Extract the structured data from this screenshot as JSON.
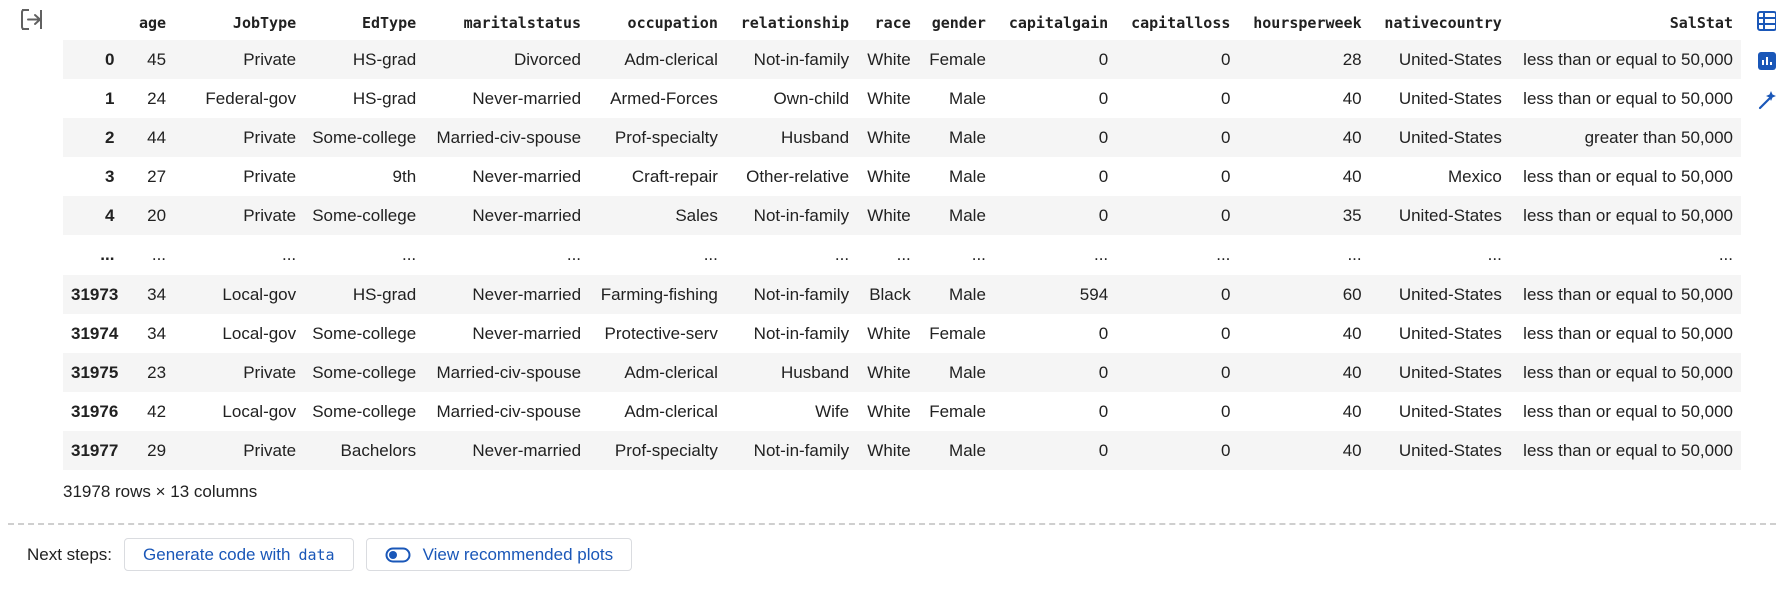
{
  "table": {
    "columns": [
      "",
      "age",
      "JobType",
      "EdType",
      "maritalstatus",
      "occupation",
      "relationship",
      "race",
      "gender",
      "capitalgain",
      "capitalloss",
      "hoursperweek",
      "nativecountry",
      "SalStat"
    ],
    "rows": [
      [
        "0",
        "45",
        "Private",
        "HS-grad",
        "Divorced",
        "Adm-clerical",
        "Not-in-family",
        "White",
        "Female",
        "0",
        "0",
        "28",
        "United-States",
        "less than or equal to 50,000"
      ],
      [
        "1",
        "24",
        "Federal-gov",
        "HS-grad",
        "Never-married",
        "Armed-Forces",
        "Own-child",
        "White",
        "Male",
        "0",
        "0",
        "40",
        "United-States",
        "less than or equal to 50,000"
      ],
      [
        "2",
        "44",
        "Private",
        "Some-college",
        "Married-civ-spouse",
        "Prof-specialty",
        "Husband",
        "White",
        "Male",
        "0",
        "0",
        "40",
        "United-States",
        "greater than 50,000"
      ],
      [
        "3",
        "27",
        "Private",
        "9th",
        "Never-married",
        "Craft-repair",
        "Other-relative",
        "White",
        "Male",
        "0",
        "0",
        "40",
        "Mexico",
        "less than or equal to 50,000"
      ],
      [
        "4",
        "20",
        "Private",
        "Some-college",
        "Never-married",
        "Sales",
        "Not-in-family",
        "White",
        "Male",
        "0",
        "0",
        "35",
        "United-States",
        "less than or equal to 50,000"
      ],
      [
        "...",
        "...",
        "...",
        "...",
        "...",
        "...",
        "...",
        "...",
        "...",
        "...",
        "...",
        "...",
        "...",
        "..."
      ],
      [
        "31973",
        "34",
        "Local-gov",
        "HS-grad",
        "Never-married",
        "Farming-fishing",
        "Not-in-family",
        "Black",
        "Male",
        "594",
        "0",
        "60",
        "United-States",
        "less than or equal to 50,000"
      ],
      [
        "31974",
        "34",
        "Local-gov",
        "Some-college",
        "Never-married",
        "Protective-serv",
        "Not-in-family",
        "White",
        "Female",
        "0",
        "0",
        "40",
        "United-States",
        "less than or equal to 50,000"
      ],
      [
        "31975",
        "23",
        "Private",
        "Some-college",
        "Married-civ-spouse",
        "Adm-clerical",
        "Husband",
        "White",
        "Male",
        "0",
        "0",
        "40",
        "United-States",
        "less than or equal to 50,000"
      ],
      [
        "31976",
        "42",
        "Local-gov",
        "Some-college",
        "Married-civ-spouse",
        "Adm-clerical",
        "Wife",
        "White",
        "Female",
        "0",
        "0",
        "40",
        "United-States",
        "less than or equal to 50,000"
      ],
      [
        "31977",
        "29",
        "Private",
        "Bachelors",
        "Never-married",
        "Prof-specialty",
        "Not-in-family",
        "White",
        "Male",
        "0",
        "0",
        "40",
        "United-States",
        "less than or equal to 50,000"
      ]
    ],
    "shape_text": "31978 rows × 13 columns"
  },
  "next_steps": {
    "label": "Next steps:",
    "generate_label": "Generate code with",
    "generate_code": "data",
    "plots_label": "View recommended plots"
  },
  "icons": {
    "output": "output-toggle-icon",
    "rail": [
      "table-icon",
      "chart-icon",
      "magic-icon"
    ],
    "plots": "toggle-icon"
  },
  "colors": {
    "accent": "#1a57b8",
    "icon": "#616161",
    "stripe": "#f5f5f5"
  }
}
